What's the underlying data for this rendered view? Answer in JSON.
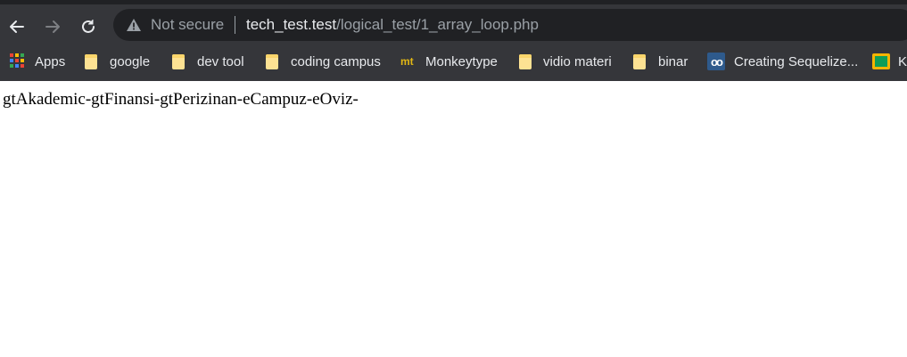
{
  "browser": {
    "security_label": "Not secure",
    "url_host": "tech_test.test",
    "url_path": "/logical_test/1_array_loop.php"
  },
  "bookmarks": [
    {
      "label": "Apps",
      "icon": "apps-grid-icon"
    },
    {
      "label": "google",
      "icon": "folder-icon"
    },
    {
      "label": "dev tool",
      "icon": "folder-icon"
    },
    {
      "label": "coding campus",
      "icon": "folder-icon"
    },
    {
      "label": "Monkeytype",
      "icon": "monkeytype-icon"
    },
    {
      "label": "vidio materi",
      "icon": "folder-icon"
    },
    {
      "label": "binar",
      "icon": "folder-icon"
    },
    {
      "label": "Creating Sequelize...",
      "icon": "sequelize-icon"
    },
    {
      "label": "K",
      "icon": "classroom-icon"
    }
  ],
  "page": {
    "output_text": "gtAkademic-gtFinansi-gtPerizinan-eCampuz-eOviz-"
  },
  "colors": {
    "chrome_bg": "#35363a",
    "omnibox_bg": "#202124",
    "text_light": "#e8eaed",
    "text_muted": "#9aa0a6"
  }
}
